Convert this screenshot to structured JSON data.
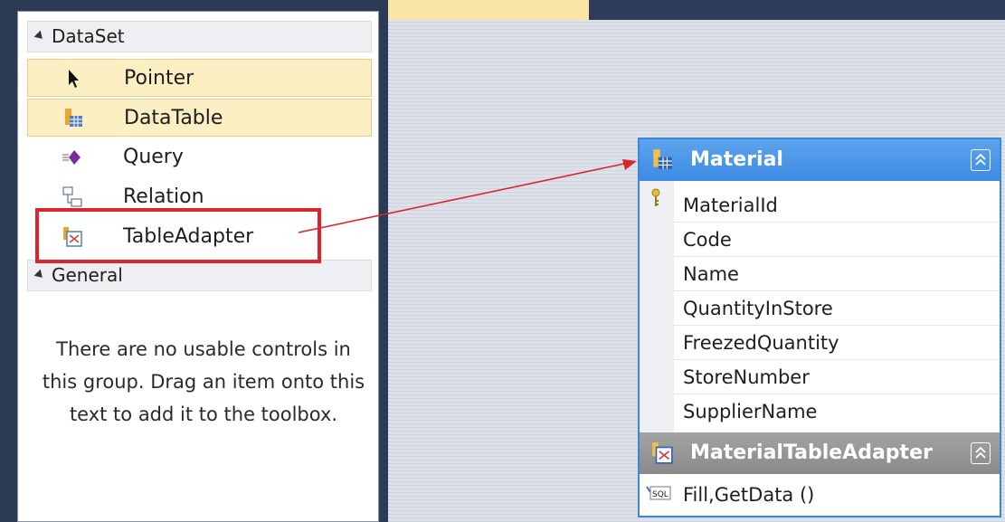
{
  "toolbox": {
    "dataset_group": "DataSet",
    "items": [
      {
        "label": "Pointer",
        "icon": "pointer-icon"
      },
      {
        "label": "DataTable",
        "icon": "datatable-icon"
      },
      {
        "label": "Query",
        "icon": "query-icon"
      },
      {
        "label": "Relation",
        "icon": "relation-icon"
      },
      {
        "label": "TableAdapter",
        "icon": "tableadapter-icon"
      }
    ],
    "general_group": "General",
    "empty_message": "There are no usable controls in this group. Drag an item onto this text to add it to the toolbox."
  },
  "designer": {
    "table": {
      "title": "Material",
      "columns": [
        "MaterialId",
        "Code",
        "Name",
        "QuantityInStore",
        "FreezedQuantity",
        "StoreNumber",
        "SupplierName"
      ],
      "primary_key": "MaterialId"
    },
    "adapter": {
      "title": "MaterialTableAdapter",
      "method": "Fill,GetData ()"
    }
  },
  "colors": {
    "highlight_box": "#d9262c",
    "table_header": "#3c8ae4",
    "adapter_header": "#8a8a8a",
    "toolbox_selected": "#fcefc3"
  }
}
